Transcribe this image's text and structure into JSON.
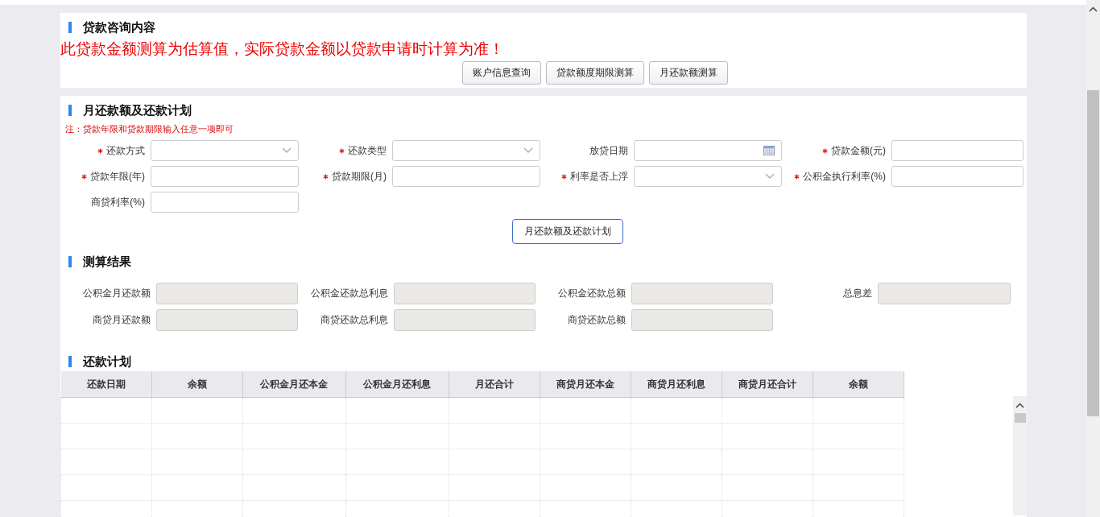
{
  "consult": {
    "title": "贷款咨询内容",
    "notice": "此贷款金额测算为估算值，实际贷款金额以贷款申请时计算为准！",
    "buttons": [
      "账户信息查询",
      "贷款额度期限测算",
      "月还款额测算"
    ]
  },
  "plan_form": {
    "title": "月还款额及还款计划",
    "note": "注：贷款年限和贷款期限输入任意一项即可",
    "fields": [
      {
        "label": "还款方式",
        "required": true,
        "kind": "select"
      },
      {
        "label": "还款类型",
        "required": true,
        "kind": "select"
      },
      {
        "label": "放贷日期",
        "required": false,
        "kind": "date"
      },
      {
        "label": "贷款金额(元)",
        "required": true,
        "kind": "text"
      },
      {
        "label": "贷款年限(年)",
        "required": true,
        "kind": "text"
      },
      {
        "label": "贷款期限(月)",
        "required": true,
        "kind": "text"
      },
      {
        "label": "利率是否上浮",
        "required": true,
        "kind": "select"
      },
      {
        "label": "公积金执行利率(%)",
        "required": true,
        "kind": "text"
      },
      {
        "label": "商贷利率(%)",
        "required": false,
        "kind": "text"
      }
    ],
    "submit": "月还款额及还款计划"
  },
  "results": {
    "title": "测算结果",
    "fields": [
      "公积金月还款额",
      "公积金还款总利息",
      "公积金还款总额",
      "总息差",
      "商贷月还款额",
      "商贷还款总利息",
      "商贷还款总额"
    ]
  },
  "schedule": {
    "title": "还款计划",
    "columns": [
      "还款日期",
      "余额",
      "公积金月还本金",
      "公积金月还利息",
      "月还合计",
      "商贷月还本金",
      "商贷月还利息",
      "商贷月还合计",
      "余额"
    ]
  }
}
